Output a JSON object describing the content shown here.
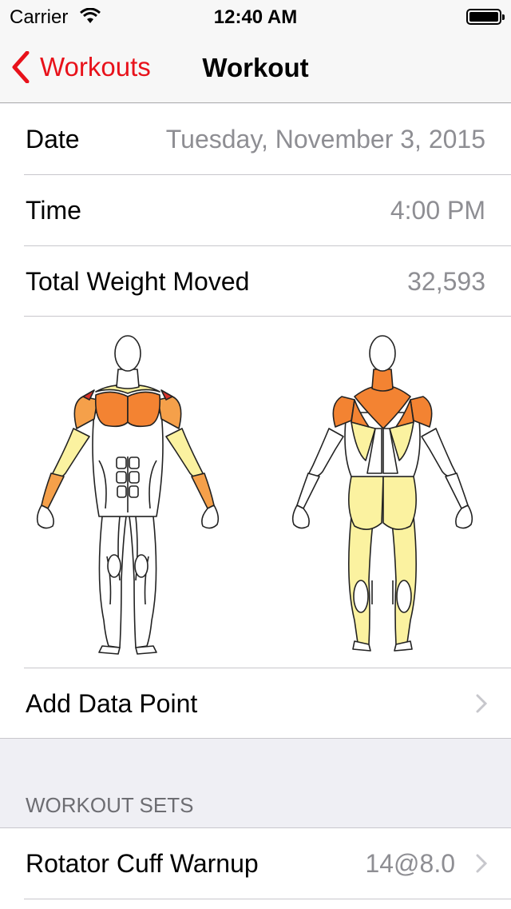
{
  "status_bar": {
    "carrier": "Carrier",
    "time": "12:40 AM"
  },
  "nav": {
    "back_label": "Workouts",
    "title": "Workout"
  },
  "details": {
    "date_label": "Date",
    "date_value": "Tuesday, November 3, 2015",
    "time_label": "Time",
    "time_value": "4:00 PM",
    "weight_label": "Total Weight Moved",
    "weight_value": "32,593"
  },
  "add_data_point_label": "Add Data Point",
  "sets_header": "WORKOUT SETS",
  "sets": [
    {
      "name": "Rotator Cuff Warnup",
      "value": "14@8.0"
    }
  ],
  "colors": {
    "accent": "#e8121b",
    "muscle_high": "#f38332",
    "muscle_medium": "#f5a04a",
    "muscle_low": "#fbf2a0",
    "muscle_max": "#d9322a"
  }
}
